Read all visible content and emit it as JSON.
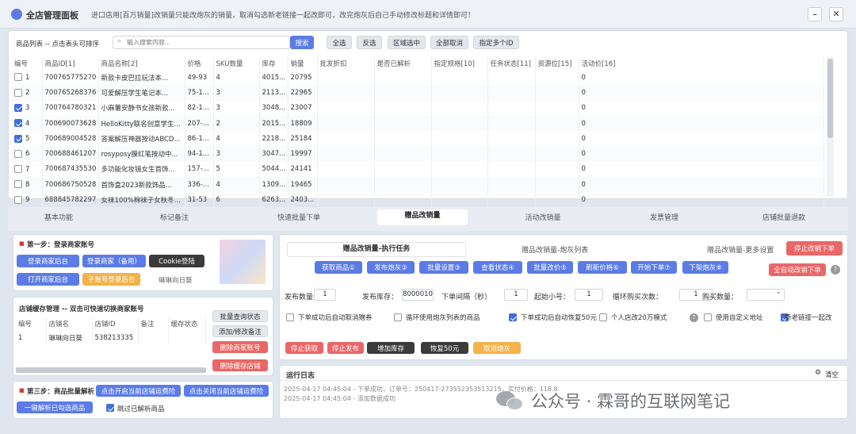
{
  "titlebar": {
    "title": "全店管理面板",
    "notice": "进口店用[百万销量]改销量只能改炮灰的销量，取消勾选新老链接一起改即可，改完炮灰后自己手动修改标题和详情即可！"
  },
  "list": {
    "heading": "商品列表 -- 点击表头可排序",
    "search_placeholder": "输入搜索内容...",
    "search_btn": "搜索",
    "buttons": [
      "全选",
      "反选",
      "区域选中",
      "全部取消",
      "指定多个ID"
    ],
    "columns": [
      "编号",
      "商品ID[1]",
      "商品名称[2]",
      "价格",
      "SKU数量",
      "库存",
      "销量",
      "批发折扣",
      "是否已解析",
      "指定规格[10]",
      "任务状态[11]",
      "资源位[15]",
      "活动价[16]"
    ],
    "rows": [
      {
        "no": "1",
        "id": "700765775270",
        "name": "新款卡皮巴拉玩法本...",
        "price": "49-93",
        "sku": "4",
        "stock": "4015...",
        "sales": "20795",
        "promo": "0",
        "checked": false
      },
      {
        "no": "2",
        "id": "700765268376",
        "name": "可爱解压学生笔记本...",
        "price": "75-1...",
        "sku": "3",
        "stock": "2113...",
        "sales": "22965",
        "promo": "0",
        "checked": false
      },
      {
        "no": "3",
        "id": "700764780321",
        "name": "小麻薯安静书女孩新款...",
        "price": "82-1...",
        "sku": "3",
        "stock": "3048...",
        "sales": "23007",
        "promo": "0",
        "checked": true
      },
      {
        "no": "4",
        "id": "700690073628",
        "name": "HelloKitty联名创意学生...",
        "price": "207-...",
        "sku": "2",
        "stock": "2015...",
        "sales": "18809",
        "promo": "0",
        "checked": true
      },
      {
        "no": "5",
        "id": "700689004528",
        "name": "答案解压神器按动ABCD...",
        "price": "86-1...",
        "sku": "4",
        "stock": "2218...",
        "sales": "25184",
        "promo": "0",
        "checked": true
      },
      {
        "no": "6",
        "id": "700688461207",
        "name": "rosyposy膜红笔按动中...",
        "price": "94-1...",
        "sku": "3",
        "stock": "3047...",
        "sales": "19997",
        "promo": "0",
        "checked": false
      },
      {
        "no": "7",
        "id": "700687435530",
        "name": "多功能化妆镜女生首饰...",
        "price": "157-...",
        "sku": "5",
        "stock": "5044...",
        "sales": "24141",
        "promo": "0",
        "checked": false
      },
      {
        "no": "8",
        "id": "700686750528",
        "name": "首饰盒2023新款饰品...",
        "price": "336-...",
        "sku": "4",
        "stock": "1309...",
        "sales": "19465",
        "promo": "0",
        "checked": false
      },
      {
        "no": "9",
        "id": "688845782297",
        "name": "女袜100%棉袜子女秋冬...",
        "price": "31-53",
        "sku": "6",
        "stock": "6263...",
        "sales": "2403...",
        "promo": "0",
        "checked": false
      }
    ]
  },
  "tabs": [
    "基本功能",
    "标记备注",
    "快速批量下单",
    "赠品改销量",
    "活动改销量",
    "发票管理",
    "店铺批量退款"
  ],
  "step1": {
    "title": "第一步：登录商家账号",
    "login": "登录商家后台",
    "login_backup": "登录商家（备用）",
    "cookie": "Cookie登陆",
    "open": "打开商家后台",
    "sub_account": "子账号登录后台",
    "shop": "琳琳向日葵"
  },
  "cache": {
    "title": "店铺缓存管理 -- 双击可快速切换商家账号",
    "columns": [
      "编号",
      "店铺名",
      "店铺ID",
      "备注",
      "缓存状态"
    ],
    "rows": [
      {
        "no": "1",
        "name": "琳琳向日葵",
        "id": "538213335"
      }
    ],
    "buttons": [
      "批量查询状态",
      "添加/修改备注",
      "删除商家账号",
      "删除缓存店铺"
    ]
  },
  "step3": {
    "title": "第三步：商品批量解析",
    "parse_all": "点击开启当前店铺运费险",
    "close_insure": "点击关闭当前店铺运费险",
    "parse_checked": "一键解析已勾选商品",
    "skip": "跳过已解析商品"
  },
  "task": {
    "subtabs": [
      "赠品改销量-执行任务",
      "赠品改销量-炮灰列表",
      "赠品改销量-更多设置"
    ],
    "stop_btn": "停止改销下单",
    "auto_btn": "全自动改销下单",
    "actions": [
      "获取商品①",
      "发布炮灰②",
      "批量设置③",
      "查看状态④",
      "批量改价⑤",
      "刷新价格⑥",
      "开始下单⑦",
      "下架炮灰⑧"
    ],
    "fields": [
      {
        "label": "发布数量：",
        "value": "1"
      },
      {
        "label": "发布库存：",
        "value": "8000010"
      },
      {
        "label": "下单间隔（秒）",
        "value": "1"
      },
      {
        "label": "起始小号：",
        "value": "1"
      },
      {
        "label": "循环购买次数：",
        "value": "1"
      },
      {
        "label": "购买数量：",
        "value": ""
      }
    ],
    "options": [
      {
        "label": "下单成功后自动取消赠券",
        "on": false
      },
      {
        "label": "循环使用炮灰列表的商品",
        "on": false
      },
      {
        "label": "下单成功后自动恢复50元",
        "on": true
      },
      {
        "label": "个人店改20万模式",
        "on": false
      },
      {
        "label": "使用自定义地址",
        "on": false
      },
      {
        "label": "新老链接一起改",
        "on": true
      }
    ],
    "bottom": [
      "停止获取",
      "停止发布",
      "增加库存",
      "恢复50元",
      "取消炮灰"
    ]
  },
  "log": {
    "title": "运行日志",
    "clear": "清空",
    "lines": [
      "2025-04-17 04:45:04 - 下单成功，订单号：250417-273552353513215，实付价格：118.8",
      "2025-04-17 04:45:04 - 添加数据成功"
    ]
  },
  "watermark": "公众号 · 霖哥的互联网笔记",
  "colors": {
    "accent": "#5b7ce6",
    "danger": "#ea6767",
    "check": "#3f6fe0"
  }
}
